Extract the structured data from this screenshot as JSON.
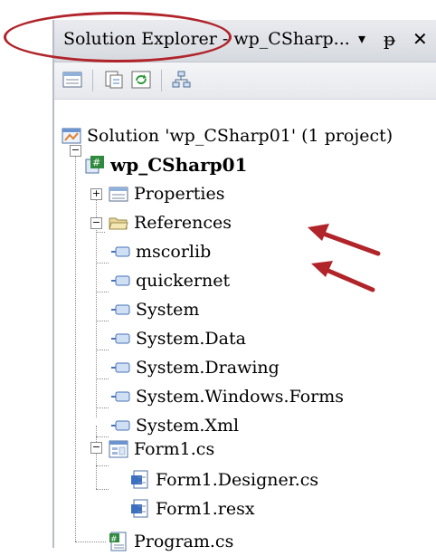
{
  "panel": {
    "title": "Solution Explorer - wp_CSharp...",
    "buttons": {
      "dropdown": "▾",
      "pin": "ᵽ",
      "close": "✕"
    }
  },
  "tree": {
    "solution": "Solution 'wp_CSharp01' (1 project)",
    "project": "wp_CSharp01",
    "properties": "Properties",
    "references": "References",
    "refs": [
      "mscorlib",
      "quickernet",
      "System",
      "System.Data",
      "System.Drawing",
      "System.Windows.Forms",
      "System.Xml"
    ],
    "form": "Form1.cs",
    "form_children": [
      "Form1.Designer.cs",
      "Form1.resx"
    ],
    "program": "Program.cs"
  },
  "annotations": {
    "highlight_color": "#b0242a"
  }
}
